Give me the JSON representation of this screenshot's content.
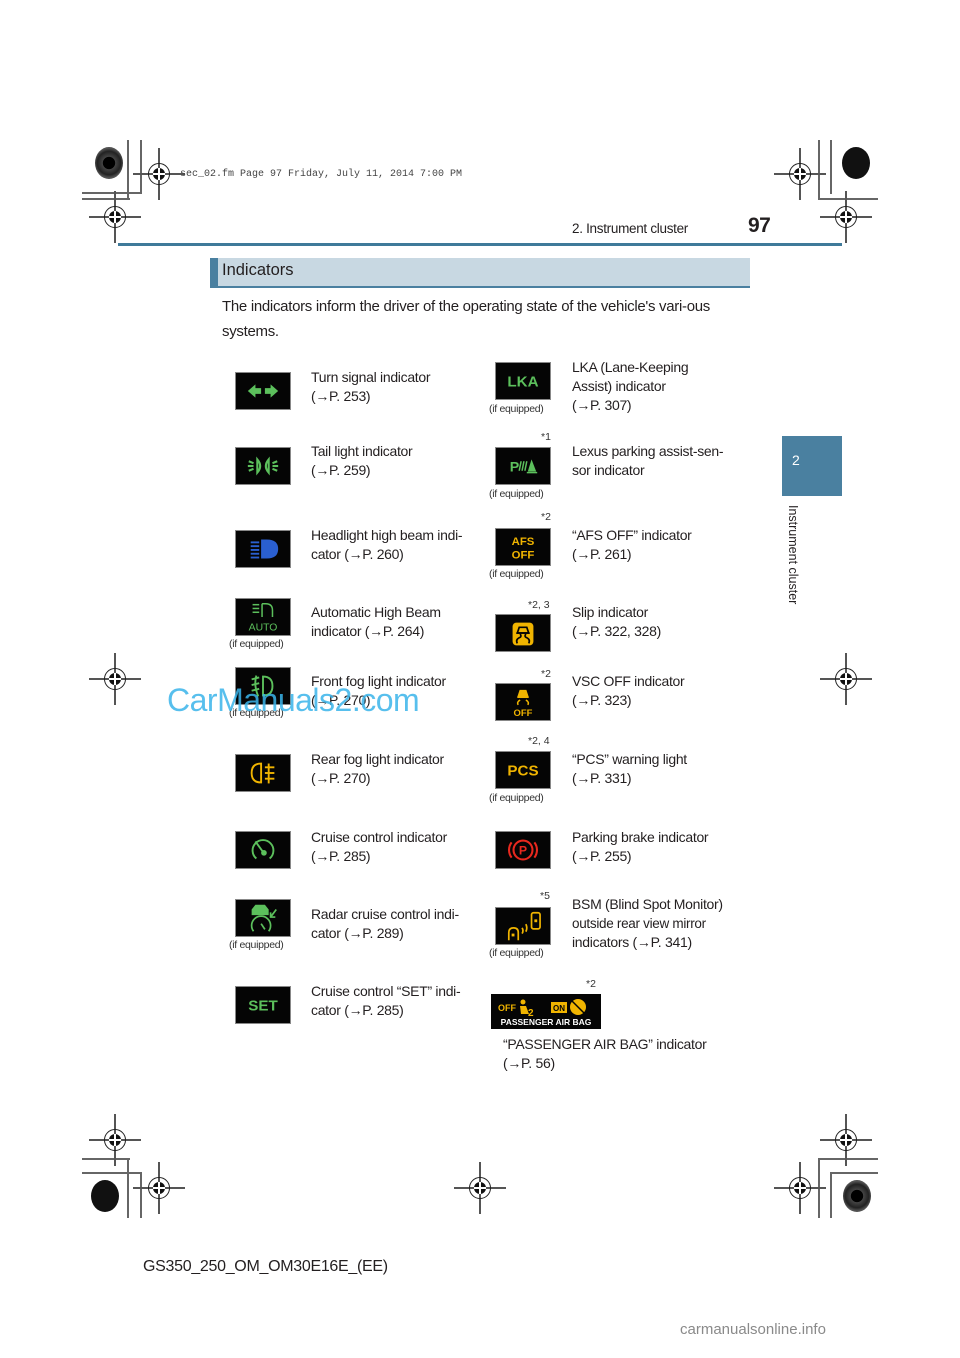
{
  "file_info": "sec_02.fm  Page 97  Friday, July 11, 2014  7:00 PM",
  "header": {
    "section": "2. Instrument cluster",
    "page_number": "97"
  },
  "side_tab": {
    "number": "2",
    "label": "Instrument cluster"
  },
  "section": {
    "title": "Indicators",
    "intro": "The indicators inform the driver of the operating state of the vehicle's vari-ous systems."
  },
  "if_equipped_label": "(if equipped)",
  "indicators_left": [
    {
      "icon": "turn-signal-icon",
      "text_lines": [
        "Turn signal indicator",
        "(→P. 253)"
      ],
      "if_equipped": false,
      "color": "#5cc05c"
    },
    {
      "icon": "tail-light-icon",
      "text_lines": [
        "Tail light indicator",
        "(→P. 259)"
      ],
      "if_equipped": false,
      "color": "#5cc05c"
    },
    {
      "icon": "high-beam-icon",
      "text_lines": [
        "Headlight high beam indi-",
        "cator (→P. 260)"
      ],
      "if_equipped": false,
      "color": "#2a5fd0"
    },
    {
      "icon": "auto-high-beam-icon",
      "text_lines": [
        "Automatic High Beam",
        "indicator (→P. 264)"
      ],
      "if_equipped": true,
      "color": "#5cc05c",
      "icon_text": "AUTO"
    },
    {
      "icon": "front-fog-light-icon",
      "text_lines": [
        "Front fog light indicator",
        "(→P. 270)"
      ],
      "if_equipped": true,
      "color": "#5cc05c"
    },
    {
      "icon": "rear-fog-light-icon",
      "text_lines": [
        "Rear fog light indicator",
        "(→P. 270)"
      ],
      "if_equipped": false,
      "color": "#f0b400"
    },
    {
      "icon": "cruise-control-icon",
      "text_lines": [
        "Cruise control indicator",
        "(→P. 285)"
      ],
      "if_equipped": false,
      "color": "#5cc05c"
    },
    {
      "icon": "radar-cruise-icon",
      "text_lines": [
        "Radar cruise control indi-",
        "cator (→P. 289)"
      ],
      "if_equipped": true,
      "color": "#5cc05c"
    },
    {
      "icon": "cruise-set-icon",
      "text_lines": [
        "Cruise control “SET” indi-",
        "cator (→P. 285)"
      ],
      "if_equipped": false,
      "color": "#5cc05c",
      "icon_text": "SET"
    }
  ],
  "indicators_right": [
    {
      "icon": "lka-icon",
      "text_lines": [
        "LKA (Lane-Keeping",
        "Assist) indicator",
        "(→P. 307)"
      ],
      "if_equipped": true,
      "note": "",
      "color": "#5cc05c",
      "icon_text": "LKA"
    },
    {
      "icon": "parking-assist-icon",
      "text_lines": [
        "Lexus parking assist-sen-",
        "sor indicator"
      ],
      "if_equipped": true,
      "note": "*1",
      "color": "#5cc05c"
    },
    {
      "icon": "afs-off-icon",
      "text_lines": [
        "“AFS OFF” indicator",
        "(→P. 261)"
      ],
      "if_equipped": true,
      "note": "*2",
      "color": "#f0b400",
      "icon_text": [
        "AFS",
        "OFF"
      ]
    },
    {
      "icon": "slip-icon",
      "text_lines": [
        "Slip indicator",
        "(→P. 322, 328)"
      ],
      "if_equipped": false,
      "note": "*2, 3",
      "color": "#f0b400"
    },
    {
      "icon": "vsc-off-icon",
      "text_lines": [
        "VSC OFF indicator",
        "(→P. 323)"
      ],
      "if_equipped": false,
      "note": "*2",
      "color": "#f0b400",
      "icon_text": "OFF"
    },
    {
      "icon": "pcs-icon",
      "text_lines": [
        "“PCS” warning light",
        "(→P. 331)"
      ],
      "if_equipped": true,
      "note": "*2, 4",
      "color": "#f0b400",
      "icon_text": "PCS"
    },
    {
      "icon": "parking-brake-icon",
      "text_lines": [
        "Parking brake indicator",
        "(→P. 255)"
      ],
      "if_equipped": false,
      "note": "",
      "color": "#e8281e"
    },
    {
      "icon": "bsm-icon",
      "text_lines": [
        "BSM (Blind Spot Monitor)",
        "outside rear view mirror",
        "indicators (→P. 341)"
      ],
      "if_equipped": true,
      "note": "*5",
      "color": "#f0b400"
    }
  ],
  "passenger_airbag": {
    "note": "*2",
    "icon_off": "OFF",
    "icon_on": "ON",
    "icon_caption": "PASSENGER  AIR BAG",
    "text_lines": [
      "“PASSENGER AIR BAG” indicator",
      "(→P. 56)"
    ],
    "color": "#f0b400"
  },
  "footer": "GS350_250_OM_OM30E16E_(EE)",
  "watermarks": {
    "left": "CarManuals2.com",
    "bottom": "carmanualsonline.info"
  }
}
